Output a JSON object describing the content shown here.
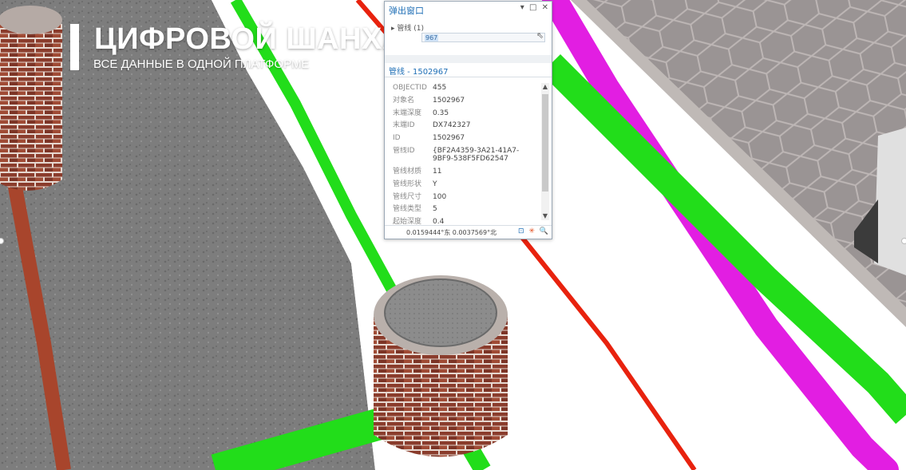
{
  "brand": {
    "title": "ЦИФРОВОЙ ШАНХАЙ",
    "subtitle": "ВСЕ ДАННЫЕ В ОДНОЙ ПЛАТФОРМЕ"
  },
  "popup": {
    "title": "弹出窗口",
    "controls": [
      "▾",
      "□",
      "✕"
    ],
    "layer_label": "▸ 管线 (1)",
    "search_value": "967",
    "feature_title": "管线 - 1502967",
    "attributes": [
      {
        "key": "OBJECTID",
        "value": "455"
      },
      {
        "key": "对象名",
        "value": "1502967"
      },
      {
        "key": "末端深度",
        "value": "0.35"
      },
      {
        "key": "末端ID",
        "value": "DX742327"
      },
      {
        "key": "ID",
        "value": "1502967"
      },
      {
        "key": "管线ID",
        "value": "{BF2A4359-3A21-41A7-9BF9-538F5FD62547"
      },
      {
        "key": "管线材质",
        "value": "11"
      },
      {
        "key": "管线形状",
        "value": "Y"
      },
      {
        "key": "管线尺寸",
        "value": "100"
      },
      {
        "key": "管线类型",
        "value": "5"
      },
      {
        "key": "起始深度",
        "value": "0.4"
      }
    ],
    "coordinates": "0.0159444°东 0.0037569°北",
    "footer_icons": [
      "⊡",
      "✳",
      "🔍"
    ],
    "scroll_up": "▲",
    "scroll_down": "▼"
  },
  "colors": {
    "pipe_green": "#22dd1a",
    "pipe_red": "#e8220e",
    "pipe_magenta": "#e21ee2",
    "brick": "#9c4a34",
    "accent_blue": "#1f6fb6"
  }
}
